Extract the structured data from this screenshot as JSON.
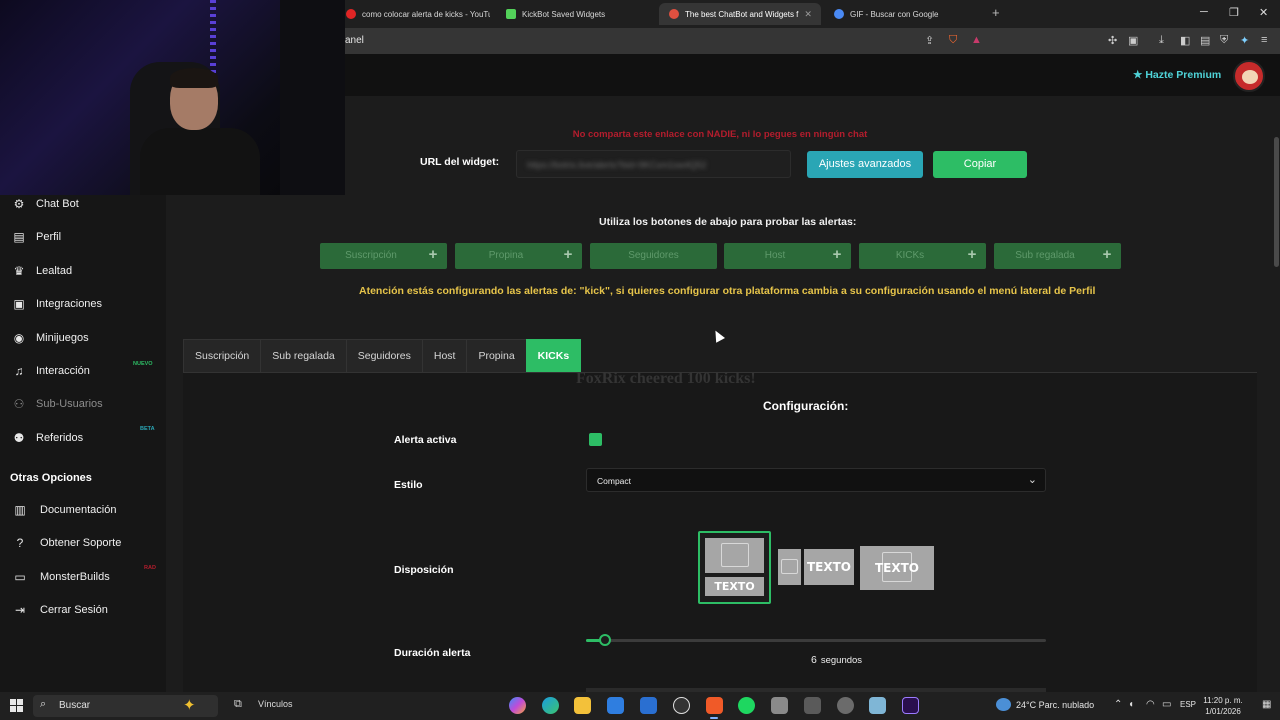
{
  "browser": {
    "tabs": [
      {
        "label": "como colocar alerta de kicks - YouTu",
        "favicon_color": "#e02525",
        "active": false
      },
      {
        "label": "KickBot Saved Widgets",
        "favicon_color": "#53d15a",
        "active": false
      },
      {
        "label": "The best ChatBot and Widgets f",
        "favicon_color": "#e05040",
        "active": true
      },
      {
        "label": "GIF - Buscar con Google",
        "favicon_color": "#4a8af4",
        "active": false
      }
    ],
    "address": "anel"
  },
  "header": {
    "premium_label": "Hazte Premium",
    "premium_icon": "star-icon"
  },
  "sidebar": {
    "items": [
      {
        "label": "Chat Bot",
        "icon": "robot-icon"
      },
      {
        "label": "Perfil",
        "icon": "id-card-icon"
      },
      {
        "label": "Lealtad",
        "icon": "trophy-icon"
      },
      {
        "label": "Integraciones",
        "icon": "plug-icon"
      },
      {
        "label": "Minijuegos",
        "icon": "gamepad-icon"
      },
      {
        "label": "Interacción",
        "icon": "music-icon",
        "badge": "NUEVO",
        "badge_color": "#2dbd65"
      },
      {
        "label": "Sub-Usuarios",
        "icon": "users-icon",
        "dim": true
      },
      {
        "label": "Referidos",
        "icon": "user-group-icon",
        "badge": "BETA",
        "badge_color": "#2aa6b5"
      }
    ],
    "other_title": "Otras Opciones",
    "other_items": [
      {
        "label": "Documentación",
        "icon": "book-icon"
      },
      {
        "label": "Obtener Soporte",
        "icon": "help-icon"
      },
      {
        "label": "MonsterBuilds",
        "icon": "laptop-icon",
        "badge": "RAD",
        "badge_color": "#b31d2d"
      },
      {
        "label": "Cerrar Sesión",
        "icon": "logout-icon"
      }
    ]
  },
  "main": {
    "warning_red": "No comparta este enlace con NADIE, ni lo pegues en ningún chat",
    "url_label": "URL del widget:",
    "url_value": "https://botrix.live/alerts?bid=9KCxm1sw4Q52",
    "advanced_button": "Ajustes avanzados",
    "copy_button": "Copiar",
    "test_title": "Utiliza los botones de abajo para probar las alertas:",
    "test_buttons": [
      {
        "label": "Suscripción",
        "plus": true
      },
      {
        "label": "Propina",
        "plus": true
      },
      {
        "label": "Seguidores",
        "plus": false
      },
      {
        "label": "Host",
        "plus": true
      },
      {
        "label": "KICKs",
        "plus": true
      },
      {
        "label": "Sub regalada",
        "plus": true
      }
    ],
    "plus_glyph": "+",
    "notice": "Atención estás configurando las alertas de: \"kick\", si quieres configurar otra plataforma cambia a su configuración usando el menú lateral de Perfil"
  },
  "alert_tabs": [
    "Suscripción",
    "Sub regalada",
    "Seguidores",
    "Host",
    "Propina",
    "KICKs"
  ],
  "active_alert_tab": "KICKs",
  "config": {
    "preview_text": "FoxRix cheered 100 kicks!",
    "title": "Configuración:",
    "active_label": "Alerta activa",
    "active_value": true,
    "style_label": "Estilo",
    "style_value": "Compact",
    "layout_label": "Disposición",
    "layout_text": "TEXTO",
    "layout_selected": 0,
    "duration_label": "Duración alerta",
    "duration_value": "6",
    "duration_unit": "segundos"
  },
  "taskbar": {
    "search_placeholder": "Buscar",
    "links_label": "Vínculos",
    "weather": "24°C  Parc. nublado",
    "language": "ESP",
    "time": "11:20 p. m.",
    "date": "1/01/2026"
  }
}
